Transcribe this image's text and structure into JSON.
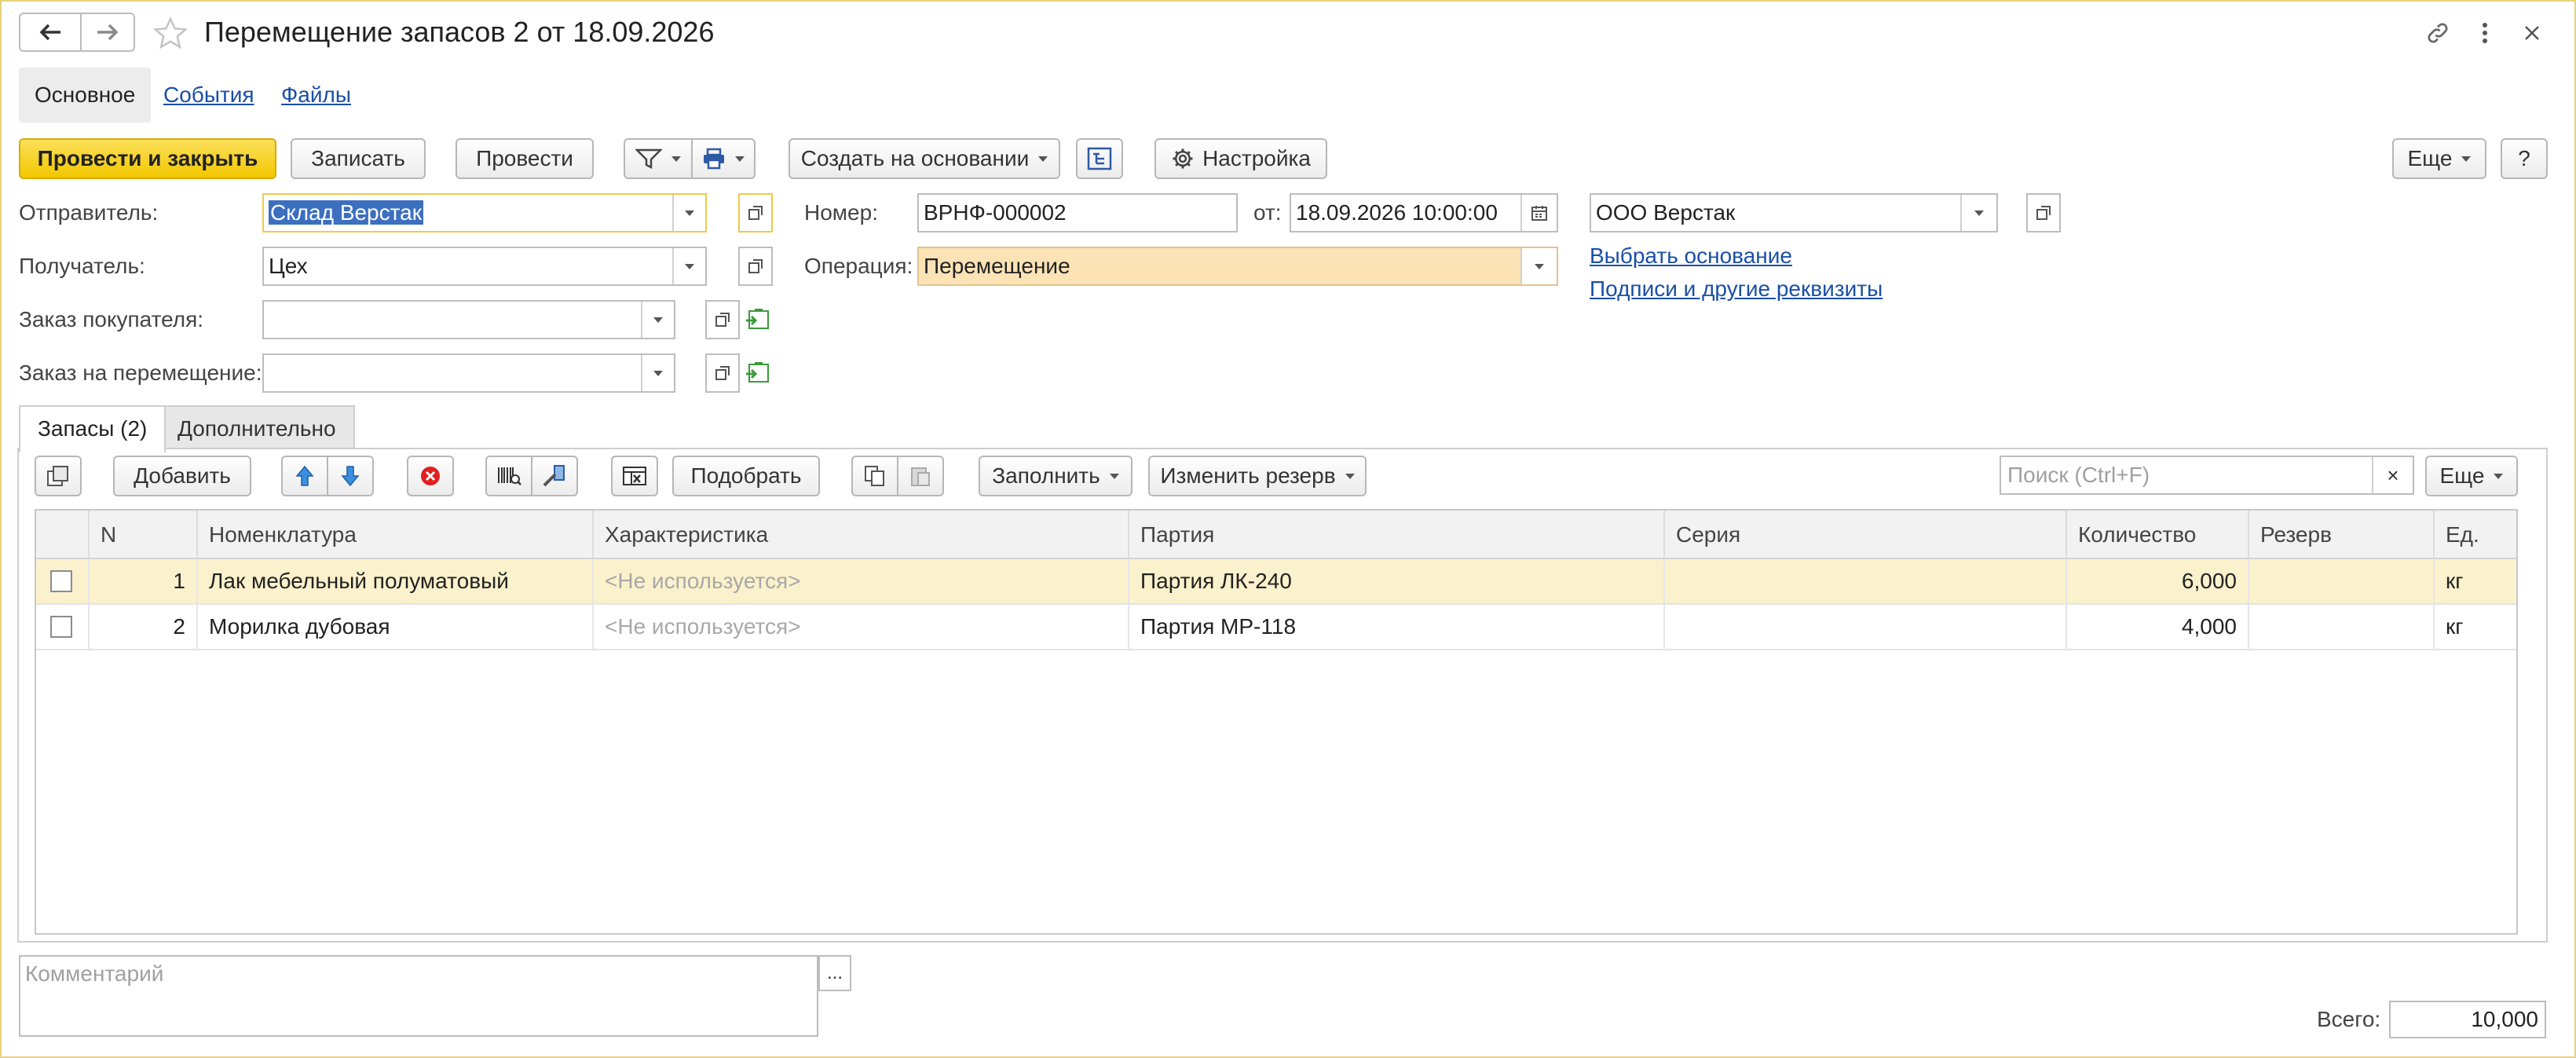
{
  "window": {
    "title": "Перемещение запасов 2 от 18.09.2026"
  },
  "sections": {
    "main": "Основное",
    "events": "События",
    "files": "Файлы"
  },
  "toolbar": {
    "post_close": "Провести и закрыть",
    "save": "Записать",
    "post": "Провести",
    "create_based": "Создать на основании",
    "settings": "Настройка",
    "more": "Еще",
    "help": "?"
  },
  "form": {
    "sender_label": "Отправитель:",
    "sender_value": "Склад Верстак",
    "receiver_label": "Получатель:",
    "receiver_value": "Цех",
    "customer_order_label": "Заказ покупателя:",
    "customer_order_value": "",
    "transfer_order_label": "Заказ на перемещение:",
    "transfer_order_value": "",
    "number_label": "Номер:",
    "number_value": "ВРНФ-000002",
    "date_label": "от:",
    "date_value": "18.09.2026 10:00:00",
    "operation_label": "Операция:",
    "operation_value": "Перемещение",
    "company_value": "ООО Верстак",
    "choose_base_link": "Выбрать основание",
    "signatures_link": "Подписи и другие реквизиты"
  },
  "tabs": {
    "stocks": "Запасы (2)",
    "additional": "Дополнительно"
  },
  "table_toolbar": {
    "add": "Добавить",
    "pick": "Подобрать",
    "fill": "Заполнить",
    "change_reserve": "Изменить резерв",
    "search_placeholder": "Поиск (Ctrl+F)",
    "more": "Еще"
  },
  "table": {
    "columns": [
      "N",
      "Номенклатура",
      "Характеристика",
      "Партия",
      "Серия",
      "Количество",
      "Резерв",
      "Ед."
    ],
    "rows": [
      {
        "n": "1",
        "item": "Лак мебельный полуматовый",
        "characteristic": "<Не используется>",
        "batch": "Партия ЛК-240",
        "series": "",
        "qty": "6,000",
        "reserve": "",
        "unit": "кг"
      },
      {
        "n": "2",
        "item": "Морилка дубовая",
        "characteristic": "<Не используется>",
        "batch": "Партия МР-118",
        "series": "",
        "qty": "4,000",
        "reserve": "",
        "unit": "кг"
      }
    ]
  },
  "footer": {
    "comment_placeholder": "Комментарий",
    "dots": "...",
    "total_label": "Всего:",
    "total_value": "10,000"
  }
}
